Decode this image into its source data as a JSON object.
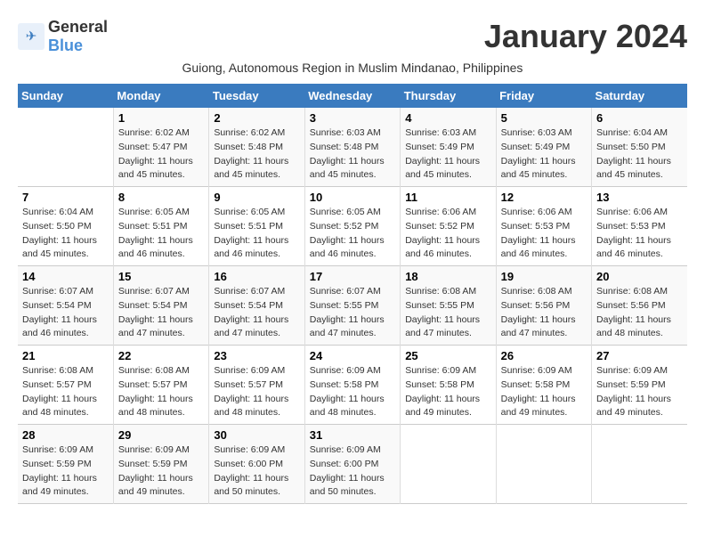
{
  "header": {
    "logo_general": "General",
    "logo_blue": "Blue",
    "month_title": "January 2024",
    "subtitle": "Guiong, Autonomous Region in Muslim Mindanao, Philippines"
  },
  "days_of_week": [
    "Sunday",
    "Monday",
    "Tuesday",
    "Wednesday",
    "Thursday",
    "Friday",
    "Saturday"
  ],
  "weeks": [
    {
      "days": [
        {
          "number": "",
          "sunrise": "",
          "sunset": "",
          "daylight": ""
        },
        {
          "number": "1",
          "sunrise": "Sunrise: 6:02 AM",
          "sunset": "Sunset: 5:47 PM",
          "daylight": "Daylight: 11 hours and 45 minutes."
        },
        {
          "number": "2",
          "sunrise": "Sunrise: 6:02 AM",
          "sunset": "Sunset: 5:48 PM",
          "daylight": "Daylight: 11 hours and 45 minutes."
        },
        {
          "number": "3",
          "sunrise": "Sunrise: 6:03 AM",
          "sunset": "Sunset: 5:48 PM",
          "daylight": "Daylight: 11 hours and 45 minutes."
        },
        {
          "number": "4",
          "sunrise": "Sunrise: 6:03 AM",
          "sunset": "Sunset: 5:49 PM",
          "daylight": "Daylight: 11 hours and 45 minutes."
        },
        {
          "number": "5",
          "sunrise": "Sunrise: 6:03 AM",
          "sunset": "Sunset: 5:49 PM",
          "daylight": "Daylight: 11 hours and 45 minutes."
        },
        {
          "number": "6",
          "sunrise": "Sunrise: 6:04 AM",
          "sunset": "Sunset: 5:50 PM",
          "daylight": "Daylight: 11 hours and 45 minutes."
        }
      ]
    },
    {
      "days": [
        {
          "number": "7",
          "sunrise": "Sunrise: 6:04 AM",
          "sunset": "Sunset: 5:50 PM",
          "daylight": "Daylight: 11 hours and 45 minutes."
        },
        {
          "number": "8",
          "sunrise": "Sunrise: 6:05 AM",
          "sunset": "Sunset: 5:51 PM",
          "daylight": "Daylight: 11 hours and 46 minutes."
        },
        {
          "number": "9",
          "sunrise": "Sunrise: 6:05 AM",
          "sunset": "Sunset: 5:51 PM",
          "daylight": "Daylight: 11 hours and 46 minutes."
        },
        {
          "number": "10",
          "sunrise": "Sunrise: 6:05 AM",
          "sunset": "Sunset: 5:52 PM",
          "daylight": "Daylight: 11 hours and 46 minutes."
        },
        {
          "number": "11",
          "sunrise": "Sunrise: 6:06 AM",
          "sunset": "Sunset: 5:52 PM",
          "daylight": "Daylight: 11 hours and 46 minutes."
        },
        {
          "number": "12",
          "sunrise": "Sunrise: 6:06 AM",
          "sunset": "Sunset: 5:53 PM",
          "daylight": "Daylight: 11 hours and 46 minutes."
        },
        {
          "number": "13",
          "sunrise": "Sunrise: 6:06 AM",
          "sunset": "Sunset: 5:53 PM",
          "daylight": "Daylight: 11 hours and 46 minutes."
        }
      ]
    },
    {
      "days": [
        {
          "number": "14",
          "sunrise": "Sunrise: 6:07 AM",
          "sunset": "Sunset: 5:54 PM",
          "daylight": "Daylight: 11 hours and 46 minutes."
        },
        {
          "number": "15",
          "sunrise": "Sunrise: 6:07 AM",
          "sunset": "Sunset: 5:54 PM",
          "daylight": "Daylight: 11 hours and 47 minutes."
        },
        {
          "number": "16",
          "sunrise": "Sunrise: 6:07 AM",
          "sunset": "Sunset: 5:54 PM",
          "daylight": "Daylight: 11 hours and 47 minutes."
        },
        {
          "number": "17",
          "sunrise": "Sunrise: 6:07 AM",
          "sunset": "Sunset: 5:55 PM",
          "daylight": "Daylight: 11 hours and 47 minutes."
        },
        {
          "number": "18",
          "sunrise": "Sunrise: 6:08 AM",
          "sunset": "Sunset: 5:55 PM",
          "daylight": "Daylight: 11 hours and 47 minutes."
        },
        {
          "number": "19",
          "sunrise": "Sunrise: 6:08 AM",
          "sunset": "Sunset: 5:56 PM",
          "daylight": "Daylight: 11 hours and 47 minutes."
        },
        {
          "number": "20",
          "sunrise": "Sunrise: 6:08 AM",
          "sunset": "Sunset: 5:56 PM",
          "daylight": "Daylight: 11 hours and 48 minutes."
        }
      ]
    },
    {
      "days": [
        {
          "number": "21",
          "sunrise": "Sunrise: 6:08 AM",
          "sunset": "Sunset: 5:57 PM",
          "daylight": "Daylight: 11 hours and 48 minutes."
        },
        {
          "number": "22",
          "sunrise": "Sunrise: 6:08 AM",
          "sunset": "Sunset: 5:57 PM",
          "daylight": "Daylight: 11 hours and 48 minutes."
        },
        {
          "number": "23",
          "sunrise": "Sunrise: 6:09 AM",
          "sunset": "Sunset: 5:57 PM",
          "daylight": "Daylight: 11 hours and 48 minutes."
        },
        {
          "number": "24",
          "sunrise": "Sunrise: 6:09 AM",
          "sunset": "Sunset: 5:58 PM",
          "daylight": "Daylight: 11 hours and 48 minutes."
        },
        {
          "number": "25",
          "sunrise": "Sunrise: 6:09 AM",
          "sunset": "Sunset: 5:58 PM",
          "daylight": "Daylight: 11 hours and 49 minutes."
        },
        {
          "number": "26",
          "sunrise": "Sunrise: 6:09 AM",
          "sunset": "Sunset: 5:58 PM",
          "daylight": "Daylight: 11 hours and 49 minutes."
        },
        {
          "number": "27",
          "sunrise": "Sunrise: 6:09 AM",
          "sunset": "Sunset: 5:59 PM",
          "daylight": "Daylight: 11 hours and 49 minutes."
        }
      ]
    },
    {
      "days": [
        {
          "number": "28",
          "sunrise": "Sunrise: 6:09 AM",
          "sunset": "Sunset: 5:59 PM",
          "daylight": "Daylight: 11 hours and 49 minutes."
        },
        {
          "number": "29",
          "sunrise": "Sunrise: 6:09 AM",
          "sunset": "Sunset: 5:59 PM",
          "daylight": "Daylight: 11 hours and 49 minutes."
        },
        {
          "number": "30",
          "sunrise": "Sunrise: 6:09 AM",
          "sunset": "Sunset: 6:00 PM",
          "daylight": "Daylight: 11 hours and 50 minutes."
        },
        {
          "number": "31",
          "sunrise": "Sunrise: 6:09 AM",
          "sunset": "Sunset: 6:00 PM",
          "daylight": "Daylight: 11 hours and 50 minutes."
        },
        {
          "number": "",
          "sunrise": "",
          "sunset": "",
          "daylight": ""
        },
        {
          "number": "",
          "sunrise": "",
          "sunset": "",
          "daylight": ""
        },
        {
          "number": "",
          "sunrise": "",
          "sunset": "",
          "daylight": ""
        }
      ]
    }
  ]
}
